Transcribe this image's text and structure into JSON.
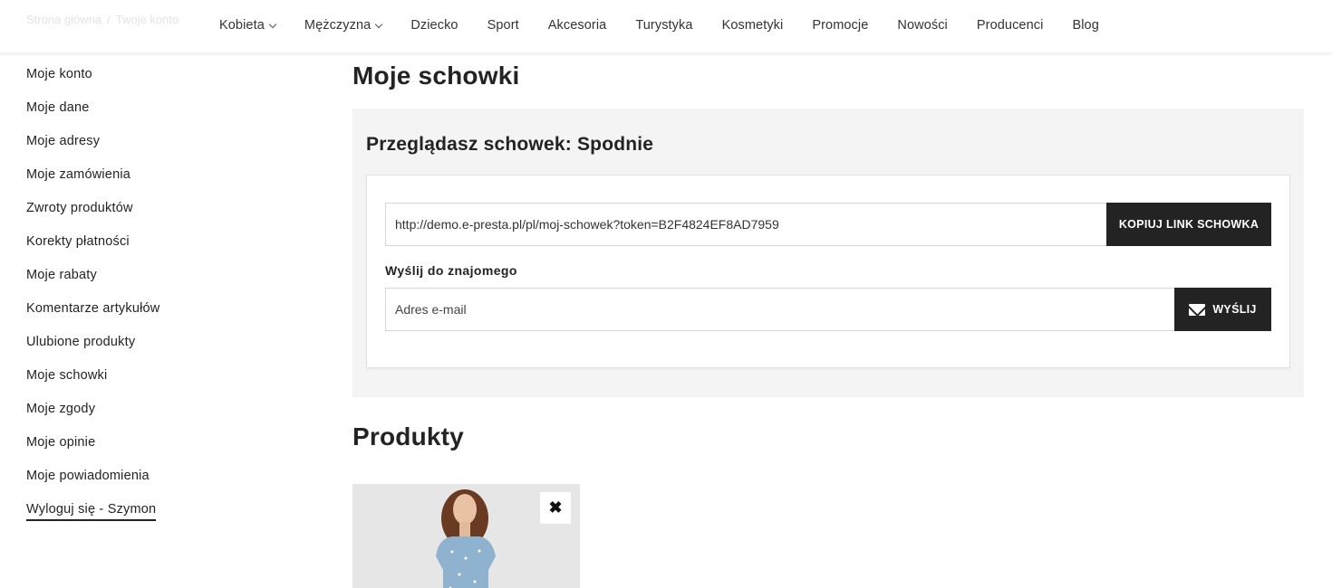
{
  "breadcrumb": [
    "Strona główna",
    "Twoje konto"
  ],
  "nav": [
    {
      "label": "Kobieta",
      "dropdown": true
    },
    {
      "label": "Mężczyzna",
      "dropdown": true
    },
    {
      "label": "Dziecko"
    },
    {
      "label": "Sport"
    },
    {
      "label": "Akcesoria"
    },
    {
      "label": "Turystyka"
    },
    {
      "label": "Kosmetyki"
    },
    {
      "label": "Promocje"
    },
    {
      "label": "Nowości"
    },
    {
      "label": "Producenci"
    },
    {
      "label": "Blog"
    }
  ],
  "sidebar": {
    "items": [
      "Moje konto",
      "Moje dane",
      "Moje adresy",
      "Moje zamówienia",
      "Zwroty produktów",
      "Korekty płatności",
      "Moje rabaty",
      "Komentarze artykułów",
      "Ulubione produkty",
      "Moje schowki",
      "Moje zgody",
      "Moje opinie",
      "Moje powiadomienia"
    ],
    "logout": "Wyloguj się - Szymon"
  },
  "main": {
    "title": "Moje schowki",
    "panel_title": "Przeglądasz schowek: Spodnie",
    "link_value": "http://demo.e-presta.pl/pl/moj-schowek?token=B2F4824EF8AD7959",
    "copy_button": "KOPIUJ LINK SCHOWKA",
    "send_label": "Wyślij do znajomego",
    "email_placeholder": "Adres e-mail",
    "send_button": "WYŚLIJ",
    "products_title": "Produkty",
    "remove_symbol": "✖"
  },
  "colors": {
    "dark": "#232323",
    "panel_bg": "#f4f4f4"
  }
}
